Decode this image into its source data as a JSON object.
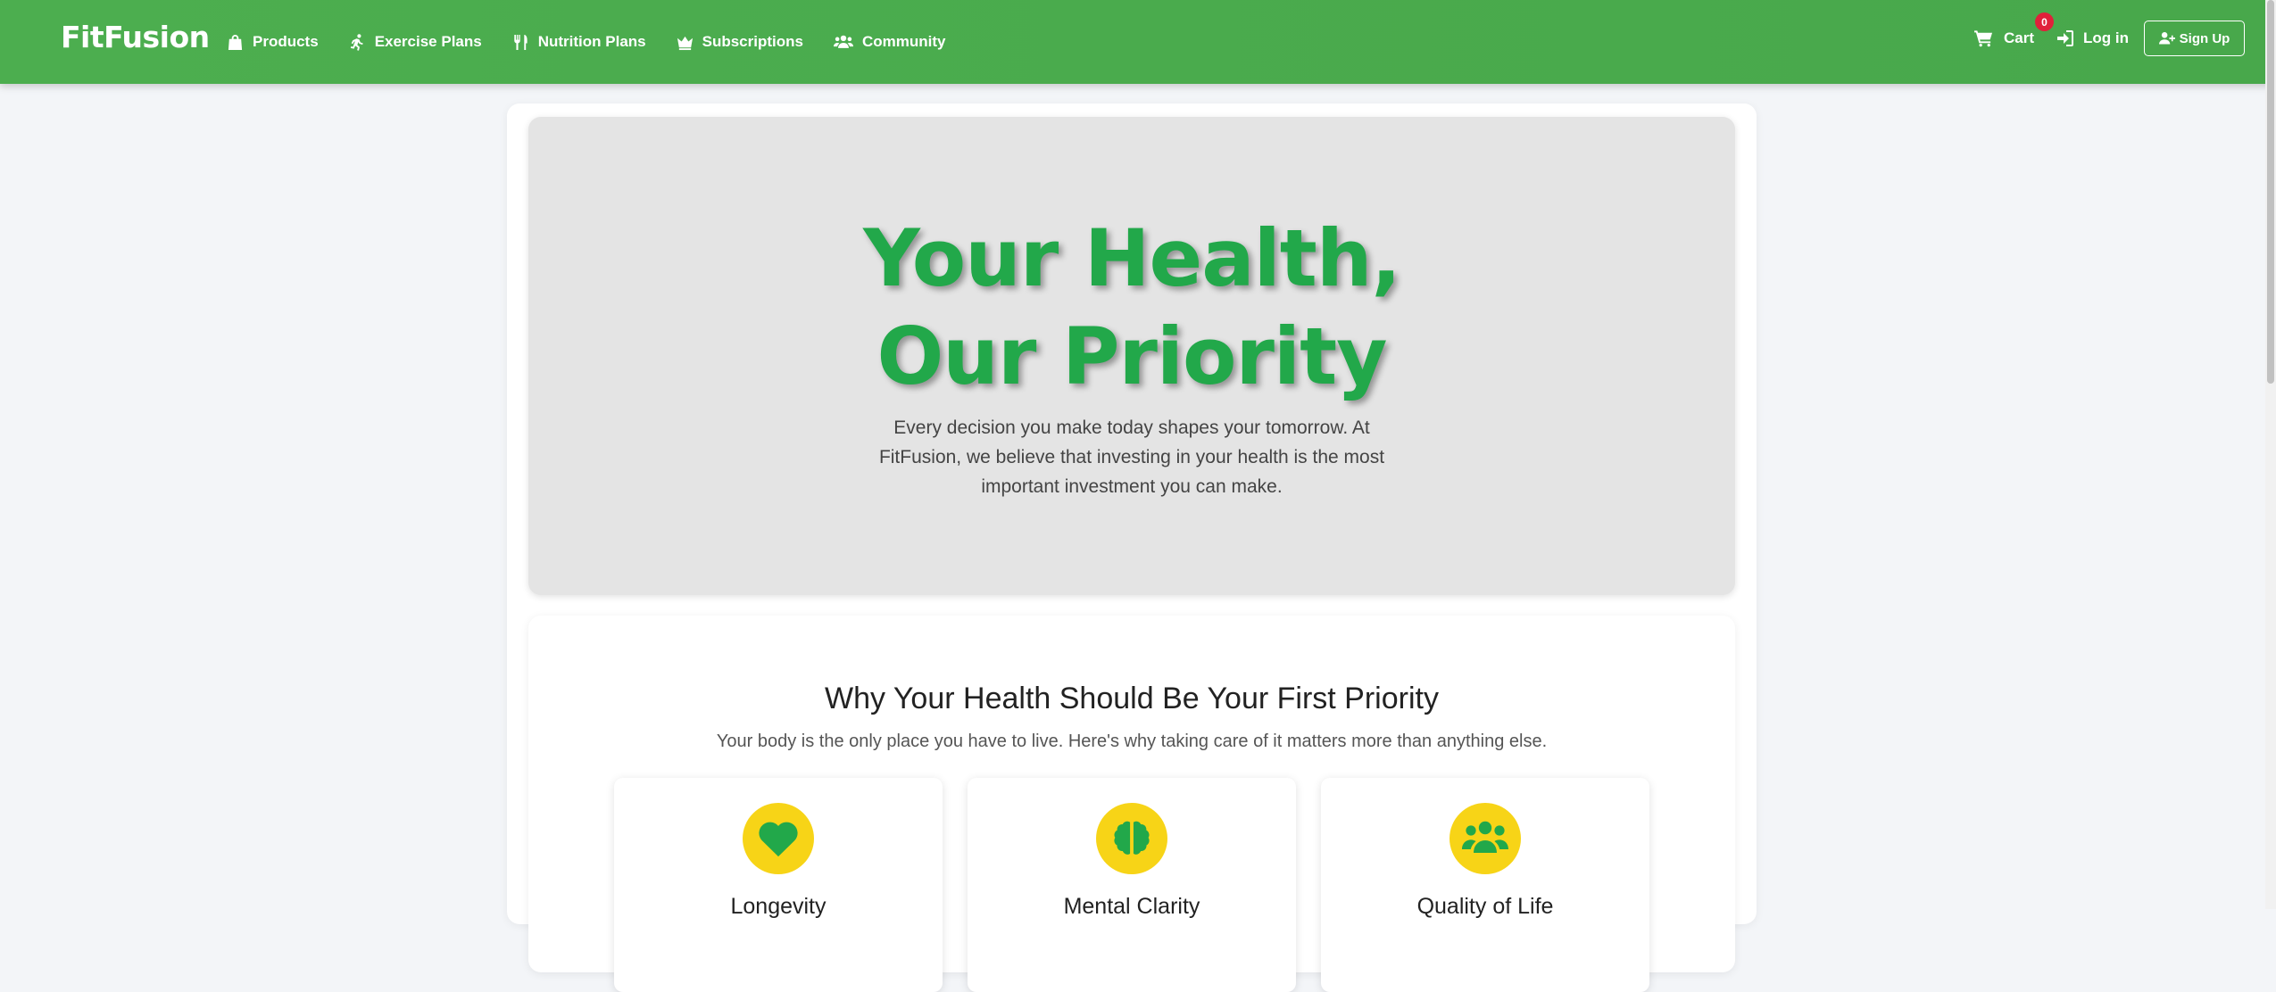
{
  "brand": "FitFusion",
  "nav": {
    "items": [
      {
        "label": "Products",
        "icon": "shopping-bag-icon"
      },
      {
        "label": "Exercise Plans",
        "icon": "running-person-icon"
      },
      {
        "label": "Nutrition Plans",
        "icon": "utensils-icon"
      },
      {
        "label": "Subscriptions",
        "icon": "crown-icon"
      },
      {
        "label": "Community",
        "icon": "users-icon"
      }
    ],
    "cart_label": "Cart",
    "cart_count": "0",
    "login_label": "Log in",
    "signup_label": "Sign Up"
  },
  "hero": {
    "title": "Your Health, Our Priority",
    "text": "Every decision you make today shapes your tomorrow. At FitFusion, we believe that investing in your health is the most important investment you can make."
  },
  "why": {
    "title": "Why Your Health Should Be Your First Priority",
    "subtitle": "Your body is the only place you have to live. Here's why taking care of it matters more than anything else.",
    "cards": [
      {
        "title": "Longevity",
        "icon": "heart-icon"
      },
      {
        "title": "Mental Clarity",
        "icon": "brain-icon"
      },
      {
        "title": "Quality of Life",
        "icon": "people-group-icon"
      }
    ]
  },
  "colors": {
    "navbar": "#4cae4f",
    "accent_green": "#22a84a",
    "icon_circle": "#f7d417",
    "badge": "#e0203a",
    "hero_bg": "#e4e4e4"
  }
}
